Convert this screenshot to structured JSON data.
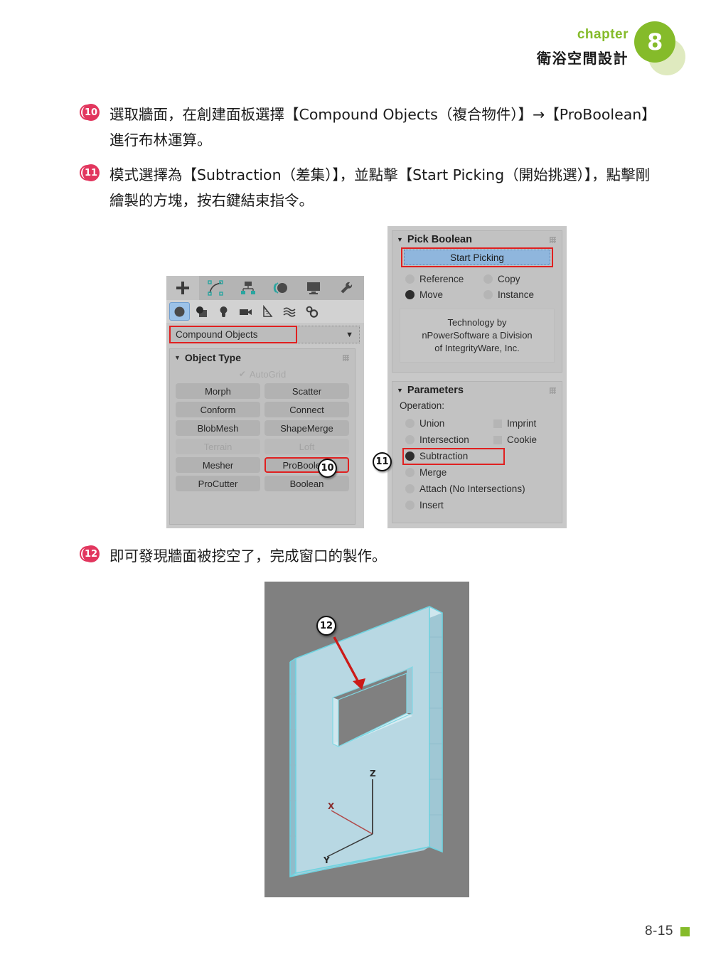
{
  "header": {
    "chapter_word": "chapter",
    "chapter_number": "8",
    "title_cn": "衛浴空間設計"
  },
  "steps": [
    {
      "number": "10",
      "text": "選取牆面，在創建面板選擇【Compound Objects（複合物件）】→【ProBoolean】進行布林運算。"
    },
    {
      "number": "11",
      "text": "模式選擇為【Subtraction（差集）】，並點擊【Start Picking（開始挑選）】，點擊剛繪製的方塊，按右鍵結束指令。"
    },
    {
      "number": "12",
      "text": "即可發現牆面被挖空了，完成窗口的製作。"
    }
  ],
  "max_panel_left": {
    "toolbar_primary": [
      {
        "icon": "create-plus-icon",
        "label": "Create"
      },
      {
        "icon": "modify-curve-icon",
        "label": "Modify"
      },
      {
        "icon": "hierarchy-icon",
        "label": "Hierarchy"
      },
      {
        "icon": "motion-icon",
        "label": "Motion"
      },
      {
        "icon": "display-monitor-icon",
        "label": "Display"
      },
      {
        "icon": "utilities-wrench-icon",
        "label": "Utilities"
      }
    ],
    "toolbar_categories": [
      {
        "icon": "geometry-sphere-icon",
        "label": "Geometry",
        "selected": true
      },
      {
        "icon": "shapes-icon",
        "label": "Shapes",
        "selected": false
      },
      {
        "icon": "lights-bulb-icon",
        "label": "Lights",
        "selected": false
      },
      {
        "icon": "cameras-icon",
        "label": "Cameras",
        "selected": false
      },
      {
        "icon": "helpers-triangle-icon",
        "label": "Helpers",
        "selected": false
      },
      {
        "icon": "spacewarps-icon",
        "label": "Space Warps",
        "selected": false
      },
      {
        "icon": "systems-gears-icon",
        "label": "Systems",
        "selected": false
      }
    ],
    "dropdown": {
      "value": "Compound Objects",
      "caret": "▼",
      "highlighted": true
    },
    "rollout": {
      "title": "Object Type",
      "autogrid": {
        "label": "AutoGrid",
        "checked": true,
        "check_glyph": "✔"
      },
      "buttons": [
        {
          "label": "Morph",
          "disabled": false,
          "highlighted": false
        },
        {
          "label": "Scatter",
          "disabled": false,
          "highlighted": false
        },
        {
          "label": "Conform",
          "disabled": false,
          "highlighted": false
        },
        {
          "label": "Connect",
          "disabled": false,
          "highlighted": false
        },
        {
          "label": "BlobMesh",
          "disabled": false,
          "highlighted": false
        },
        {
          "label": "ShapeMerge",
          "disabled": false,
          "highlighted": false
        },
        {
          "label": "Terrain",
          "disabled": true,
          "highlighted": false
        },
        {
          "label": "Loft",
          "disabled": true,
          "highlighted": false
        },
        {
          "label": "Mesher",
          "disabled": false,
          "highlighted": false
        },
        {
          "label": "ProBoolean",
          "disabled": false,
          "highlighted": true
        },
        {
          "label": "ProCutter",
          "disabled": false,
          "highlighted": false
        },
        {
          "label": "Boolean",
          "disabled": false,
          "highlighted": false
        }
      ]
    },
    "callout": "10"
  },
  "max_panel_right": {
    "pick_boolean": {
      "title": "Pick Boolean",
      "start_picking": "Start Picking",
      "start_picking_highlighted": true,
      "options": [
        {
          "label": "Reference",
          "selected": false
        },
        {
          "label": "Copy",
          "selected": false
        },
        {
          "label": "Move",
          "selected": true
        },
        {
          "label": "Instance",
          "selected": false
        }
      ],
      "technology_note": "Technology by\nnPowerSoftware a Division\nof IntegrityWare, Inc.",
      "technology_lines": [
        "Technology by",
        "nPowerSoftware a Division",
        "of IntegrityWare, Inc."
      ]
    },
    "parameters": {
      "title": "Parameters",
      "operation_label": "Operation:",
      "operations": [
        {
          "label": "Union",
          "selected": false,
          "highlighted": false
        },
        {
          "label": "Intersection",
          "selected": false,
          "highlighted": false
        },
        {
          "label": "Subtraction",
          "selected": true,
          "highlighted": true
        },
        {
          "label": "Merge",
          "selected": false,
          "highlighted": false
        },
        {
          "label": "Attach (No Intersections)",
          "selected": false,
          "highlighted": false
        },
        {
          "label": "Insert",
          "selected": false,
          "highlighted": false
        }
      ],
      "checkboxes": [
        {
          "label": "Imprint",
          "checked": false
        },
        {
          "label": "Cookie",
          "checked": false
        }
      ]
    },
    "callout": "11"
  },
  "viewport": {
    "callout": "12",
    "axis_labels": {
      "x": "X",
      "y": "Y",
      "z": "Z"
    },
    "background_color": "#808080",
    "object_color": "#b3d7e2",
    "arrow_color": "#cc1a18"
  },
  "footer": {
    "page_number": "8-15"
  },
  "colors": {
    "accent_green": "#85bb2a",
    "accent_green_light": "#dfeabf",
    "step_badge": "#e2365e",
    "highlight_red": "#e02020",
    "panel_gray": "#c8c8c8",
    "button_blue": "#8fb6dd"
  }
}
